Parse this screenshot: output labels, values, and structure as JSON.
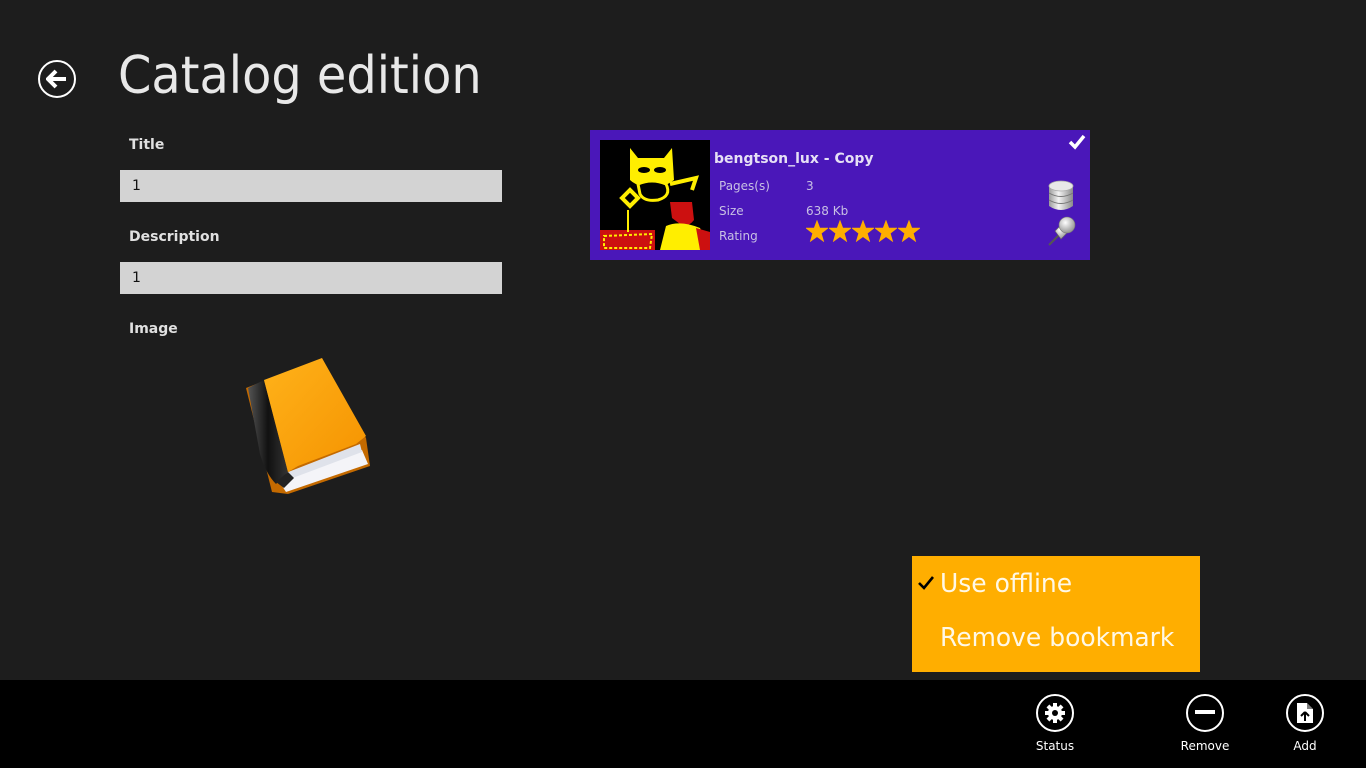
{
  "header": {
    "title": "Catalog edition",
    "back_icon": "back-arrow-circle-icon"
  },
  "form": {
    "title_label": "Title",
    "title_value": "1",
    "description_label": "Description",
    "description_value": "1",
    "image_label": "Image",
    "image_icon": "orange-book-icon"
  },
  "catalog_tile": {
    "name": "bengtson_lux - Copy",
    "selected": true,
    "thumbnail": "comic-cover-thumbnail",
    "rows": [
      {
        "label": "Pages(s)",
        "value": "3"
      },
      {
        "label": "Size",
        "value": "638 Kb"
      },
      {
        "label": "Rating",
        "value": "5"
      }
    ],
    "rating": 5,
    "rating_max": 5,
    "icons": [
      "checkmark-icon",
      "database-icon",
      "pushpin-icon"
    ],
    "background_color": "#4a17b9",
    "star_color": "#ffae00"
  },
  "context_menu": {
    "background_color": "#ffae00",
    "items": [
      {
        "label": "Use offline",
        "checked": true
      },
      {
        "label": "Remove bookmark",
        "checked": false
      }
    ]
  },
  "app_bar": {
    "buttons": [
      {
        "label": "Status",
        "icon": "gear-icon"
      },
      {
        "label": "Remove",
        "icon": "minus-icon"
      },
      {
        "label": "Add",
        "icon": "add-file-icon"
      }
    ]
  }
}
